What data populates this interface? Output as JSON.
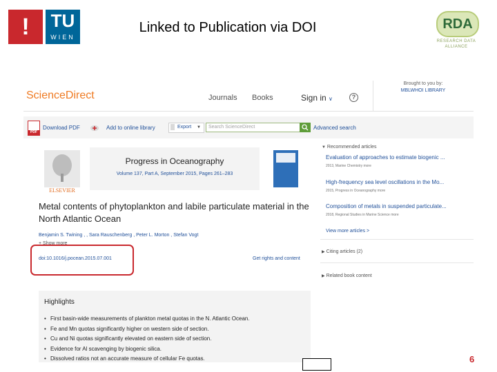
{
  "slide": {
    "title": "Linked to Publication via DOI",
    "logo_left_mark": "!",
    "logo_tu": "TU",
    "logo_wien": "WIEN",
    "logo_rda": "RDA",
    "logo_rda_sub": "RESEARCH DATA ALLIANCE",
    "page_number": "6",
    "accent_color": "#c9282d"
  },
  "header": {
    "brand": "ScienceDirect",
    "nav": [
      "Journals",
      "Books",
      "Sign in"
    ],
    "help_label": "?",
    "brought_line1": "Brought to you by:",
    "brought_line2": "MBLWHOI LIBRARY"
  },
  "toolbar": {
    "download_pdf": "Download PDF",
    "add_library": "Add to online library",
    "export": "Export",
    "search_placeholder": "Search ScienceDirect",
    "advanced_search": "Advanced search"
  },
  "article": {
    "publisher": "ELSEVIER",
    "journal": "Progress in Oceanography",
    "volume": "Volume 137, Part A, September 2015, Pages 261–283",
    "title": "Metal contents of phytoplankton and labile particulate material in the North Atlantic Ocean",
    "authors": "Benjamin S. Twining ,  ,   Sara Rauschenberg , Peter L. Morton , Stefan Vogt",
    "show_more": "+ Show more",
    "doi": "doi:10.1016/j.pocean.2015.07.001",
    "rights": "Get rights and content",
    "highlights_title": "Highlights",
    "highlights": [
      "First basin-wide measurements of plankton metal quotas in the N. Atlantic Ocean.",
      "Fe and Mn quotas significantly higher on western side of section.",
      "Cu and Ni quotas significantly elevated on eastern side of section.",
      "Evidence for Al scavenging by biogenic silica.",
      "Dissolved ratios not an accurate measure of cellular Fe quotas."
    ]
  },
  "sidebar": {
    "recommended_heading": "Recommended articles",
    "items": [
      {
        "title": "Evaluation of approaches to estimate biogenic ...",
        "meta": "2013, Marine Chemistry   more"
      },
      {
        "title": "High-frequency sea level oscillations in the Mo...",
        "meta": "2015, Progress in Oceanography   more"
      },
      {
        "title": "Composition of metals in suspended particulate...",
        "meta": "2018, Regional Studies in Marine Science   more"
      }
    ],
    "view_more": "View more articles >",
    "citing": "Citing articles (2)",
    "related": "Related book content"
  }
}
